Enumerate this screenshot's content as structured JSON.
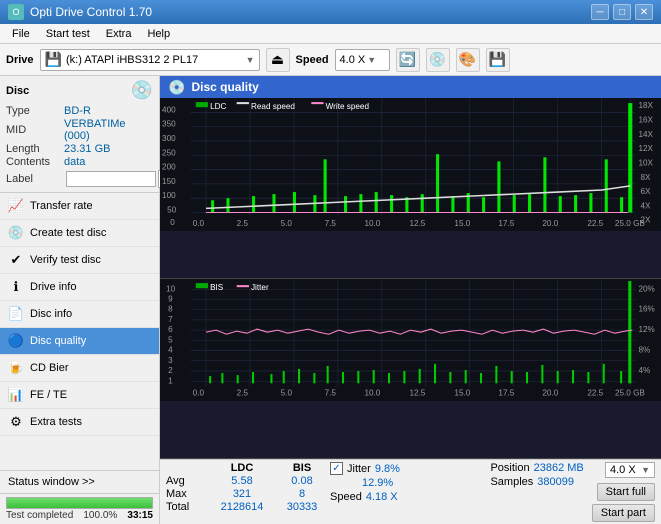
{
  "titleBar": {
    "title": "Opti Drive Control 1.70",
    "minBtn": "─",
    "maxBtn": "□",
    "closeBtn": "✕"
  },
  "menuBar": {
    "items": [
      "File",
      "Start test",
      "Extra",
      "Help"
    ]
  },
  "toolbar": {
    "driveLabel": "Drive",
    "driveName": "(k:) ATAPl iHBS312  2 PL17",
    "speedLabel": "Speed",
    "speedValue": "4.0 X"
  },
  "disc": {
    "title": "Disc",
    "typeLabel": "Type",
    "typeValue": "BD-R",
    "midLabel": "MID",
    "midValue": "VERBATIMe (000)",
    "lengthLabel": "Length",
    "lengthValue": "23.31 GB",
    "contentsLabel": "Contents",
    "contentsValue": "data",
    "labelLabel": "Label"
  },
  "navItems": [
    {
      "id": "transfer-rate",
      "label": "Transfer rate",
      "icon": "📈"
    },
    {
      "id": "create-test-disc",
      "label": "Create test disc",
      "icon": "💿"
    },
    {
      "id": "verify-test-disc",
      "label": "Verify test disc",
      "icon": "✔"
    },
    {
      "id": "drive-info",
      "label": "Drive info",
      "icon": "ℹ"
    },
    {
      "id": "disc-info",
      "label": "Disc info",
      "icon": "📄"
    },
    {
      "id": "disc-quality",
      "label": "Disc quality",
      "icon": "🔵",
      "active": true
    },
    {
      "id": "cd-bier",
      "label": "CD Bier",
      "icon": "🍺"
    },
    {
      "id": "fe-te",
      "label": "FE / TE",
      "icon": "📊"
    },
    {
      "id": "extra-tests",
      "label": "Extra tests",
      "icon": "⚙"
    }
  ],
  "statusWindow": {
    "label": "Status window >> "
  },
  "progress": {
    "statusText": "Test completed",
    "percent": 100,
    "time": "33:15"
  },
  "discQuality": {
    "title": "Disc quality",
    "legend1": {
      "chart1": [
        "LDC",
        "Read speed",
        "Write speed"
      ],
      "chart2": [
        "BIS",
        "Jitter"
      ]
    }
  },
  "chart1": {
    "yLabels": [
      "400",
      "350",
      "300",
      "250",
      "200",
      "150",
      "100",
      "50",
      "0"
    ],
    "yLabelsRight": [
      "18X",
      "16X",
      "14X",
      "12X",
      "10X",
      "8X",
      "6X",
      "4X",
      "2X"
    ],
    "xLabels": [
      "0.0",
      "2.5",
      "5.0",
      "7.5",
      "10.0",
      "12.5",
      "15.0",
      "17.5",
      "20.0",
      "22.5",
      "25.0 GB"
    ]
  },
  "chart2": {
    "yLabels": [
      "10",
      "9",
      "8",
      "7",
      "6",
      "5",
      "4",
      "3",
      "2",
      "1"
    ],
    "yLabelsRight": [
      "20%",
      "16%",
      "12%",
      "8%",
      "4%"
    ],
    "xLabels": [
      "0.0",
      "2.5",
      "5.0",
      "7.5",
      "10.0",
      "12.5",
      "15.0",
      "17.5",
      "20.0",
      "22.5",
      "25.0 GB"
    ]
  },
  "stats": {
    "headers": [
      "",
      "LDC",
      "BIS"
    ],
    "rows": [
      {
        "label": "Avg",
        "ldc": "5.58",
        "bis": "0.08"
      },
      {
        "label": "Max",
        "ldc": "321",
        "bis": "8"
      },
      {
        "label": "Total",
        "ldc": "2128614",
        "bis": "30333"
      }
    ],
    "jitterLabel": "Jitter",
    "jitterChecked": true,
    "jitterAvg": "9.8%",
    "jitterMax": "12.9%",
    "speedLabel": "Speed",
    "speedValue": "4.18 X",
    "speedSelect": "4.0 X",
    "positionLabel": "Position",
    "positionValue": "23862 MB",
    "samplesLabel": "Samples",
    "samplesValue": "380099",
    "startFullBtn": "Start full",
    "startPartBtn": "Start part"
  }
}
